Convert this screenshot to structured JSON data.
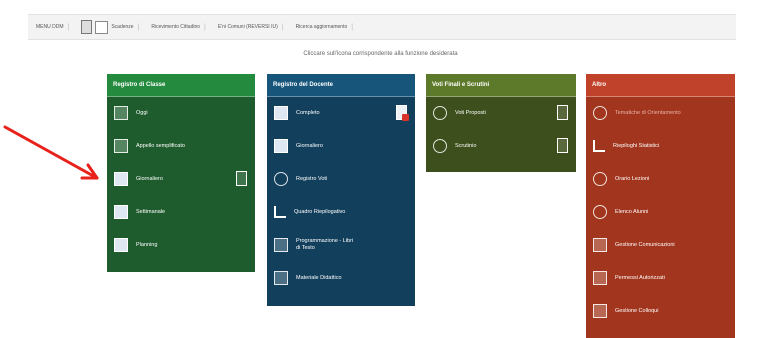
{
  "topbar": {
    "items": [
      "MENU DDM",
      "Scadenze",
      "Ricevimento Cittadino",
      "E'ni Comuni (REVERSI IU)",
      "Ricerca aggiornamento"
    ]
  },
  "hint": "Cliccare sull'icona corrispondente alla funzione desiderata",
  "panels": {
    "registro_classe": {
      "title": "Registro di Classe",
      "items": [
        "Oggi",
        "Appello semplificato",
        "Giornaliero",
        "Settimanale",
        "Planning"
      ]
    },
    "registro_docente": {
      "title": "Registro del Docente",
      "items": [
        "Completo",
        "Giornaliero",
        "Registro Voti",
        "Quadro Riepilogativo",
        "Programmazione - Libri di Testo",
        "Materiale Didattico"
      ]
    },
    "voti_finali": {
      "title": "Voti Finali e Scrutini",
      "items": [
        "Voti Proposti",
        "Scrutinio"
      ]
    },
    "altro": {
      "title": "Altro",
      "items": [
        "Tematiche di Orientamento",
        "Riepiloghi Statistici",
        "Orario Lezioni",
        "Elenco Alunni",
        "Gestione Comunicazioni",
        "Permessi Autorizzati",
        "Gestione Colloqui"
      ]
    }
  },
  "colors": {
    "arrow": "#e8221b",
    "registro_classe": "#1e5c2d",
    "registro_docente": "#123f5c",
    "voti_finali": "#3d4f1c",
    "altro": "#a2351d"
  }
}
